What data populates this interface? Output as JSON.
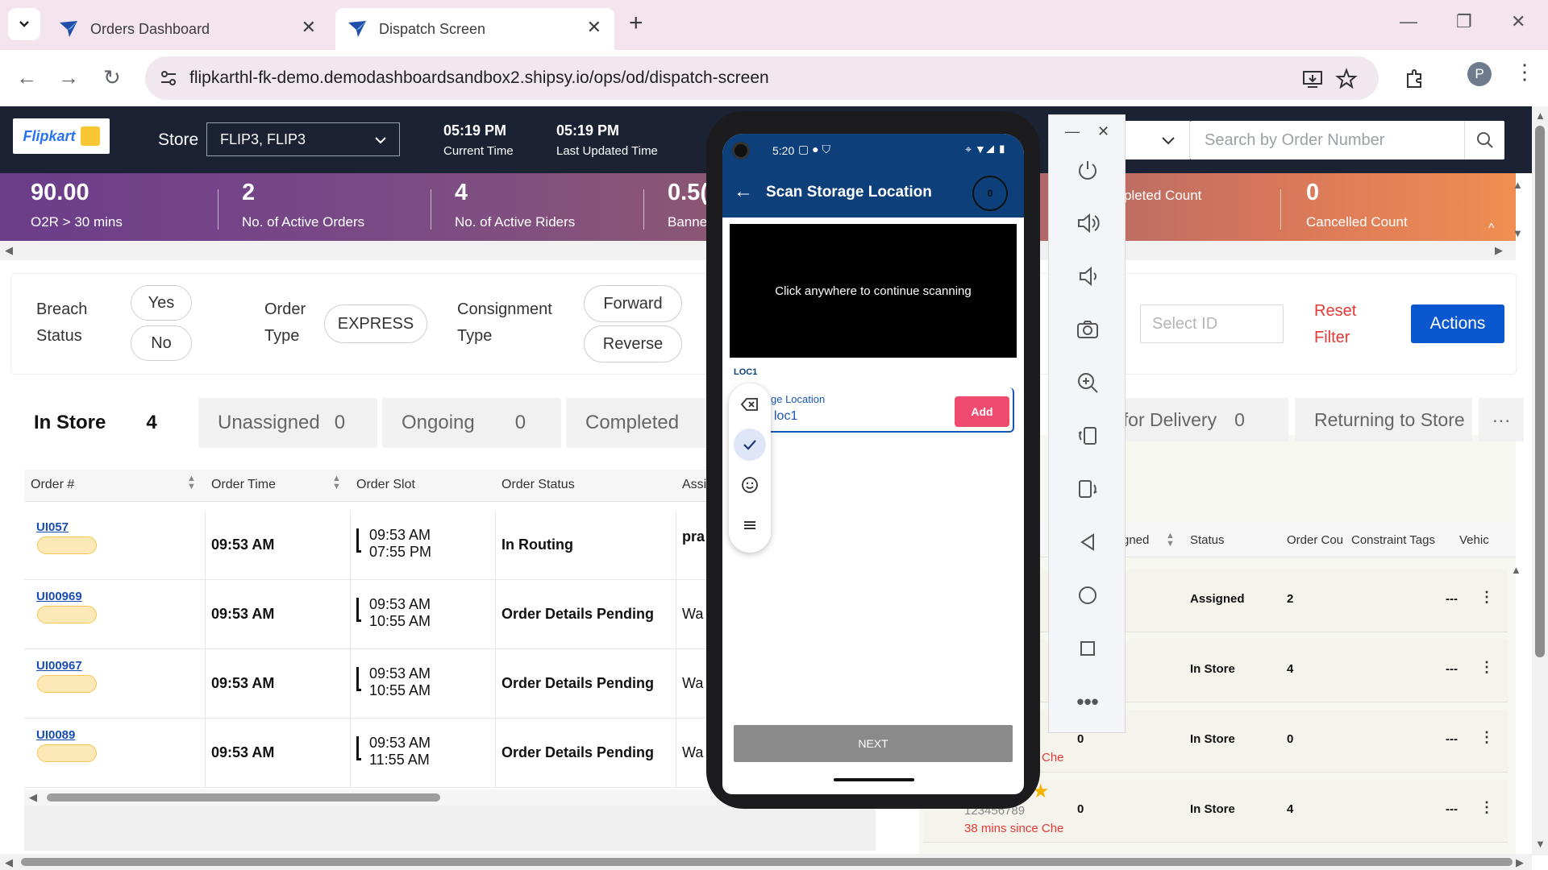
{
  "browser": {
    "tabs": [
      {
        "title": "Orders Dashboard",
        "active": false
      },
      {
        "title": "Dispatch Screen",
        "active": true
      }
    ],
    "url": "flipkarthl-fk-demo.demodashboardsandbox2.shipsy.io/ops/od/dispatch-screen",
    "profile_initial": "P"
  },
  "header": {
    "logo_text": "Flipkart",
    "store_label": "Store",
    "store_value": "FLIP3, FLIP3",
    "current_time": "05:19 PM",
    "current_time_label": "Current Time",
    "last_updated_time": "05:19 PM",
    "last_updated_label": "Last Updated Time",
    "search_placeholder": "Search by Order Number"
  },
  "metrics": [
    {
      "value": "90.00",
      "label": "O2R > 30 mins"
    },
    {
      "value": "2",
      "label": "No. of Active Orders"
    },
    {
      "value": "4",
      "label": "No. of Active Riders"
    },
    {
      "value": "0.5(",
      "label": "Banne"
    },
    {
      "value": "",
      "label": "pleted Count"
    },
    {
      "value": "0",
      "label": "Cancelled Count"
    }
  ],
  "filters": {
    "breach_label_1": "Breach",
    "breach_label_2": "Status",
    "breach_yes": "Yes",
    "breach_no": "No",
    "order_type_label_1": "Order",
    "order_type_label_2": "Type",
    "order_type_value": "EXPRESS",
    "consignment_label_1": "Consignment",
    "consignment_label_2": "Type",
    "consignment_forward": "Forward",
    "consignment_reverse": "Reverse",
    "select_id_placeholder": "Select ID",
    "reset_1": "Reset",
    "reset_2": "Filter",
    "actions": "Actions"
  },
  "status_tabs": [
    {
      "label": "In Store",
      "count": "4"
    },
    {
      "label": "Unassigned",
      "count": "0"
    },
    {
      "label": "Ongoing",
      "count": "0"
    },
    {
      "label": "Completed",
      "count": ""
    }
  ],
  "right_tabs": [
    {
      "label": "t for Delivery",
      "count": "0"
    },
    {
      "label": "Returning to Store",
      "count": ""
    }
  ],
  "more_label": "···",
  "orders_table": {
    "columns": [
      "Order #",
      "Order Time",
      "Order Slot",
      "Order Status",
      "Assi"
    ],
    "rows": [
      {
        "order": "UI057",
        "time": "09:53 AM",
        "slot_start": "09:53 AM",
        "slot_end": "07:55 PM",
        "status": "In Routing",
        "assigned": "pra"
      },
      {
        "order": "UI00969",
        "time": "09:53 AM",
        "slot_start": "09:53 AM",
        "slot_end": "10:55 AM",
        "status": "Order Details Pending",
        "assigned": "Wa"
      },
      {
        "order": "UI00967",
        "time": "09:53 AM",
        "slot_start": "09:53 AM",
        "slot_end": "10:55 AM",
        "status": "Order Details Pending",
        "assigned": "Wa"
      },
      {
        "order": "UI0089",
        "time": "09:53 AM",
        "slot_start": "09:53 AM",
        "slot_end": "11:55 AM",
        "status": "Order Details Pending",
        "assigned": "Wa"
      }
    ]
  },
  "riders_table": {
    "columns": [
      "gned",
      "Status",
      "Order Cou",
      "Constraint Tags",
      "Vehic"
    ],
    "rows": [
      {
        "assigned": "",
        "status": "Assigned",
        "orders": "2",
        "tags": "---"
      },
      {
        "assigned": "",
        "status": "In Store",
        "orders": "4",
        "tags": "---"
      },
      {
        "assigned": "0",
        "status": "In Store",
        "orders": "0",
        "tags": "---"
      },
      {
        "assigned": "0",
        "status": "In Store",
        "orders": "4",
        "tags": "---"
      }
    ],
    "rider_phone": "123456789",
    "rider_since": "38 mins since Che",
    "rider_since_short": "Che"
  },
  "phone": {
    "time": "5:20",
    "title": "Scan Storage Location",
    "counter": "0",
    "camera_text": "Click anywhere to continue scanning",
    "loc_tag": "LOC1",
    "field_label": "ge Location",
    "field_value": "loc1",
    "add_button": "Add",
    "next_button": "NEXT"
  },
  "icons": {
    "accent": "#0b57d0",
    "header_bg": "#1b2233",
    "phone_appbar": "#0d3f7a",
    "add_button": "#ef4b6f"
  }
}
